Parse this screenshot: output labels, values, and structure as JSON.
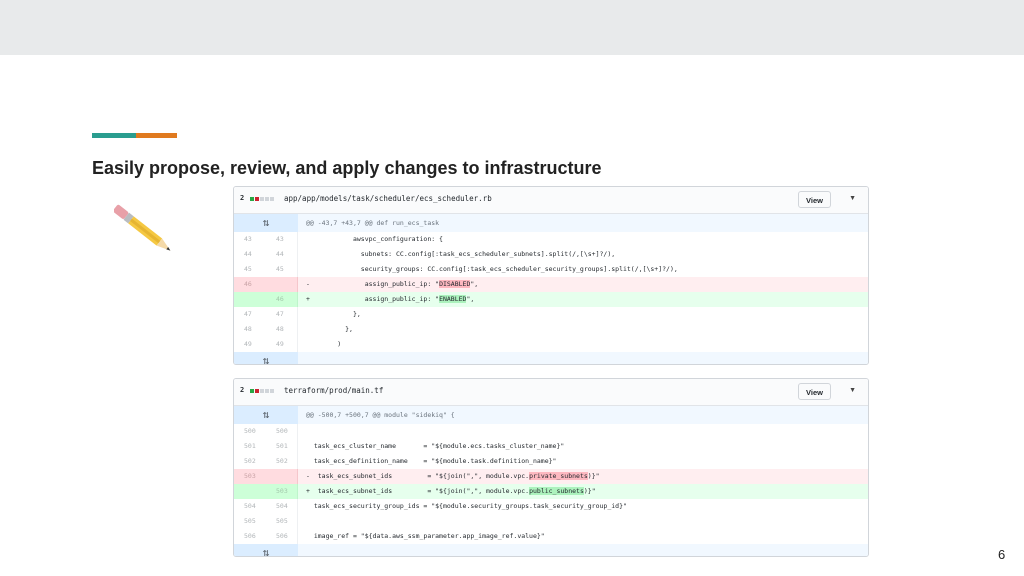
{
  "slide": {
    "title": "Easily propose, review, and apply changes to infrastructure",
    "page_number": "6",
    "colors": {
      "teal": "#2a9d8f",
      "orange": "#e07a1f",
      "topbar": "#e8eaeb"
    },
    "icon": "pencil-icon"
  },
  "diffs": [
    {
      "count": "2",
      "path": "app/app/models/task/scheduler/ecs_scheduler.rb",
      "view_label": "View",
      "hunk": "@@ -43,7 +43,7 @@ def run_ecs_task",
      "lines": [
        {
          "old": "43",
          "new": "43",
          "type": "ctx",
          "code": "            awsvpc_configuration: {"
        },
        {
          "old": "44",
          "new": "44",
          "type": "ctx",
          "code": "              subnets: CC.config[:task_ecs_scheduler_subnets].split(/,[\\s+]?/),"
        },
        {
          "old": "45",
          "new": "45",
          "type": "ctx",
          "code": "              security_groups: CC.config[:task_ecs_scheduler_security_groups].split(/,[\\s+]?/),"
        },
        {
          "old": "46",
          "new": "",
          "type": "del",
          "sign": "-",
          "pre": "              assign_public_ip: \"",
          "hl": "DISABLED",
          "post": "\","
        },
        {
          "old": "",
          "new": "46",
          "type": "add",
          "sign": "+",
          "pre": "              assign_public_ip: \"",
          "hl": "ENABLED",
          "post": "\","
        },
        {
          "old": "47",
          "new": "47",
          "type": "ctx",
          "code": "            },"
        },
        {
          "old": "48",
          "new": "48",
          "type": "ctx",
          "code": "          },"
        },
        {
          "old": "49",
          "new": "49",
          "type": "ctx",
          "code": "        )"
        }
      ]
    },
    {
      "count": "2",
      "path": "terraform/prod/main.tf",
      "view_label": "View",
      "hunk": "@@ -500,7 +500,7 @@ module \"sidekiq\" {",
      "lines": [
        {
          "old": "500",
          "new": "500",
          "type": "ctx",
          "code": ""
        },
        {
          "old": "501",
          "new": "501",
          "type": "ctx",
          "code": "  task_ecs_cluster_name       = \"${module.ecs.tasks_cluster_name}\""
        },
        {
          "old": "502",
          "new": "502",
          "type": "ctx",
          "code": "  task_ecs_definition_name    = \"${module.task.definition_name}\""
        },
        {
          "old": "503",
          "new": "",
          "type": "del",
          "sign": "-",
          "pre": "  task_ecs_subnet_ids         = \"${join(\",\", module.vpc.",
          "hl": "private_subnets",
          "post": ")}\""
        },
        {
          "old": "",
          "new": "503",
          "type": "add",
          "sign": "+",
          "pre": "  task_ecs_subnet_ids         = \"${join(\",\", module.vpc.",
          "hl": "public_subnets",
          "post": ")}\""
        },
        {
          "old": "504",
          "new": "504",
          "type": "ctx",
          "code": "  task_ecs_security_group_ids = \"${module.security_groups.task_security_group_id}\""
        },
        {
          "old": "505",
          "new": "505",
          "type": "ctx",
          "code": ""
        },
        {
          "old": "506",
          "new": "506",
          "type": "ctx",
          "code": "  image_ref = \"${data.aws_ssm_parameter.app_image_ref.value}\""
        }
      ]
    }
  ]
}
